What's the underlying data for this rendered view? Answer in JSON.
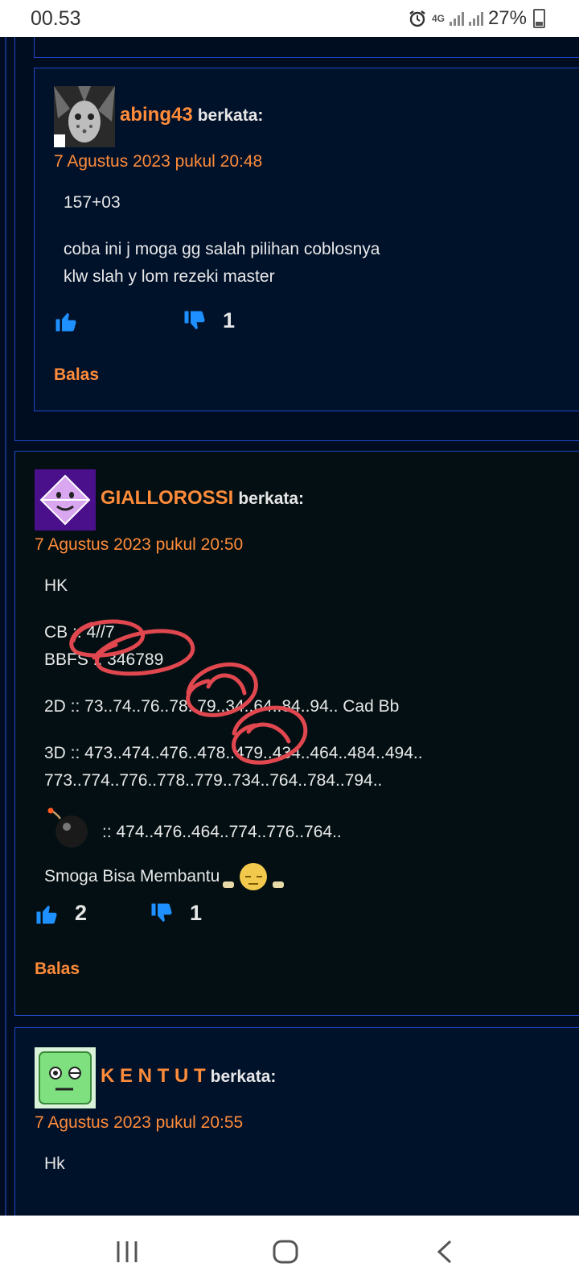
{
  "status_bar": {
    "time": "00.53",
    "network": "4G",
    "battery": "27%"
  },
  "comments": [
    {
      "author": "abing43",
      "says": "berkata:",
      "date": "7 Agustus 2023 pukul 20:48",
      "lines": [
        "157+03",
        "coba ini j moga gg salah pilihan coblosnya",
        "klw slah y lom rezeki master"
      ],
      "likes": "",
      "dislikes": "1",
      "reply": "Balas"
    },
    {
      "author": "GIALLOROSSI",
      "says": "berkata:",
      "date": "7 Agustus 2023 pukul 20:50",
      "lines": [
        "HK",
        "CB :: 4//7",
        "BBFS :: 346789",
        "2D :: 73..74..76..78..79..34..64..84..94.. Cad Bb",
        "3D :: 473..474..476..478..479..434..464..484..494..",
        "773..774..776..778..779..734..764..784..794..",
        ":: 474..476..464..774..776..764..",
        "Smoga Bisa Membantu"
      ],
      "likes": "2",
      "dislikes": "1",
      "reply": "Balas"
    },
    {
      "author": "K E N T U T",
      "says": "berkata:",
      "date": "7 Agustus 2023 pukul 20:55",
      "lines": [
        "Hk"
      ]
    }
  ],
  "colors": {
    "accent": "#ff8c3a",
    "link_blue": "#1e90ff",
    "border": "#1e47c9",
    "bg": "#000c1f"
  },
  "icons": [
    "alarm-icon",
    "signal-icon",
    "battery-icon",
    "thumbs-up-icon",
    "thumbs-down-icon",
    "bomb-emoji-icon",
    "sleepy-emoji-icon",
    "recent-apps-icon",
    "home-icon",
    "back-icon"
  ]
}
